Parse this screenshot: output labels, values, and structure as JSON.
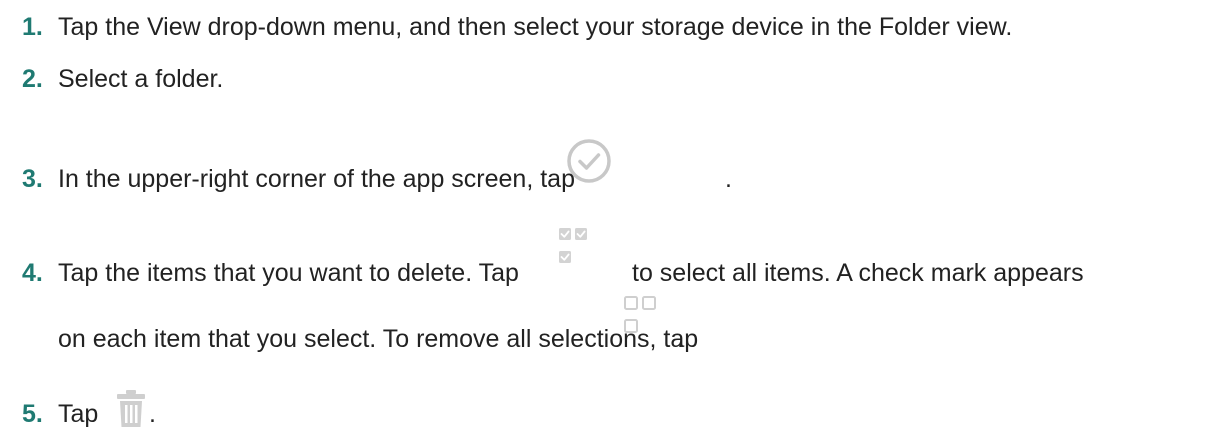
{
  "steps": [
    {
      "number": "1.",
      "text": "Tap the View drop-down menu, and then select your storage device in the Folder view."
    },
    {
      "number": "2.",
      "text": "Select a folder."
    },
    {
      "number": "3.",
      "text_before": "In the upper-right corner of the app screen, tap",
      "text_after": ".",
      "icon": "checkmark-circle-icon"
    },
    {
      "number": "4.",
      "text_1": "Tap the items that you want to delete. Tap",
      "text_2": "to select all items. A check mark appears",
      "text_3": "on each item that you select. To remove all selections, tap",
      "text_4": ".",
      "icon_select_all": "select-all-icon",
      "icon_deselect_all": "deselect-all-icon"
    },
    {
      "number": "5.",
      "text_before": "Tap",
      "text_after": ".",
      "icon": "trash-icon"
    }
  ],
  "colors": {
    "step_number": "#1f7a72",
    "text": "#222222",
    "icon": "#c8c8c8"
  }
}
